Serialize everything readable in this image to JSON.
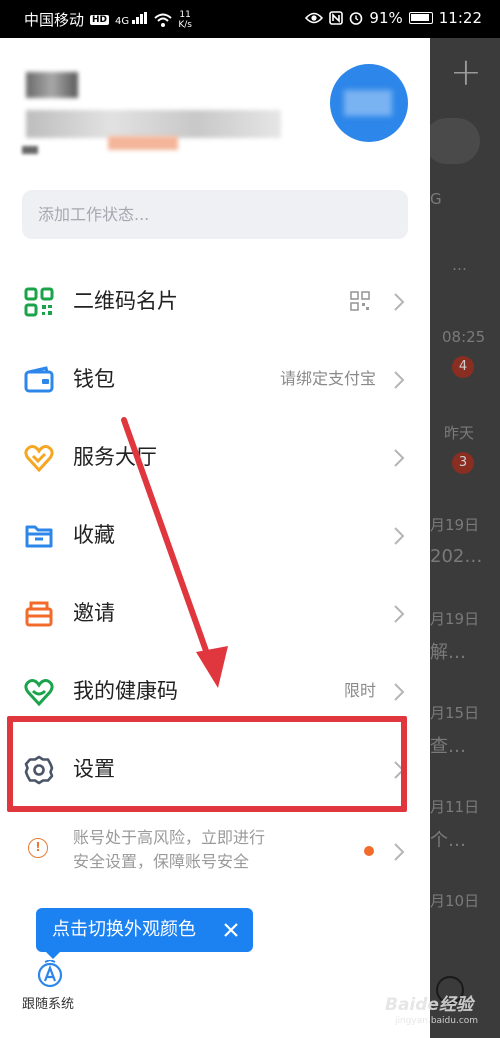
{
  "status_bar": {
    "carrier": "中国移动",
    "hd": "HD",
    "signal": "4G",
    "speed_value": "11",
    "speed_unit": "K/s",
    "battery": "91%",
    "time": "11:22"
  },
  "background_app": {
    "plus": "+",
    "letter_g": "G",
    "ellipsis": "…",
    "rows": [
      {
        "time": "08:25",
        "badge": "4"
      },
      {
        "time": "昨天",
        "badge": "3"
      },
      {
        "time": "月19日",
        "preview": "202…"
      },
      {
        "time": "月19日",
        "preview": "解…"
      },
      {
        "time": "月15日",
        "preview": "查…"
      },
      {
        "time": "月11日",
        "preview": "个…"
      },
      {
        "time": "月10日"
      }
    ]
  },
  "drawer": {
    "status_placeholder": "添加工作状态...",
    "menu": [
      {
        "label": "二维码名片",
        "trailing": "",
        "icon": "qrcode-icon",
        "color": "#1aa34a"
      },
      {
        "label": "钱包",
        "trailing": "请绑定支付宝",
        "icon": "wallet-icon",
        "color": "#2d86e9"
      },
      {
        "label": "服务大厅",
        "trailing": "",
        "icon": "heart-icon",
        "color": "#f5a623"
      },
      {
        "label": "收藏",
        "trailing": "",
        "icon": "folder-icon",
        "color": "#2d86e9"
      },
      {
        "label": "邀请",
        "trailing": "",
        "icon": "envelope-icon",
        "color": "#f26b2b"
      },
      {
        "label": "我的健康码",
        "trailing": "限时",
        "icon": "health-code-icon",
        "color": "#1aa34a"
      },
      {
        "label": "设置",
        "trailing": "",
        "icon": "gear-icon",
        "color": "#4a5568"
      }
    ],
    "warning": {
      "line1": "账号处于高风险，立即进行",
      "line2": "安全设置，保障账号安全"
    },
    "tooltip": "点击切换外观颜色",
    "follow_system": "跟随系统"
  },
  "annotation": {
    "color": "#e0373f"
  },
  "watermark": {
    "main": "Baide经验",
    "sub": "jingyan.baidu.com"
  }
}
